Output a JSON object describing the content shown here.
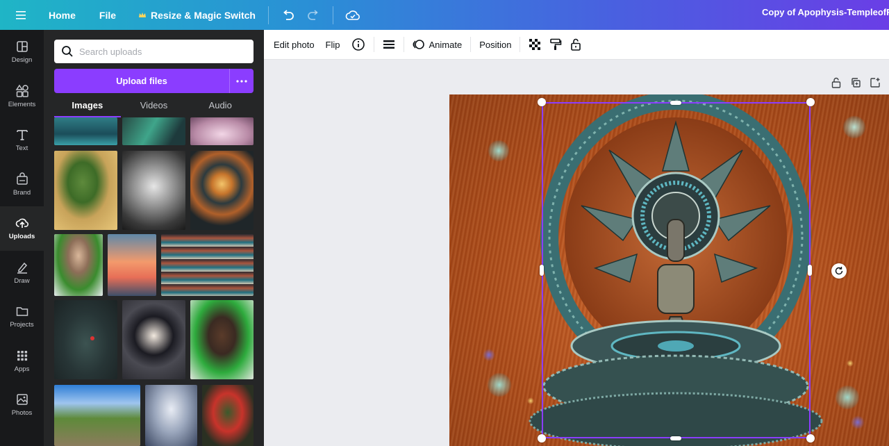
{
  "topbar": {
    "home": "Home",
    "file": "File",
    "resize": "Resize & Magic Switch",
    "doc_title": "Copy of Apophysis-TempleofRo"
  },
  "rail": {
    "items": [
      {
        "label": "Design",
        "icon": "design-icon"
      },
      {
        "label": "Elements",
        "icon": "elements-icon"
      },
      {
        "label": "Text",
        "icon": "text-icon"
      },
      {
        "label": "Brand",
        "icon": "brand-icon"
      },
      {
        "label": "Uploads",
        "icon": "upload-cloud-icon"
      },
      {
        "label": "Draw",
        "icon": "draw-icon"
      },
      {
        "label": "Projects",
        "icon": "folder-icon"
      },
      {
        "label": "Apps",
        "icon": "apps-grid-icon"
      },
      {
        "label": "Photos",
        "icon": "photo-icon"
      }
    ]
  },
  "panel": {
    "search_placeholder": "Search uploads",
    "upload_label": "Upload files",
    "tabs": [
      "Images",
      "Videos",
      "Audio"
    ]
  },
  "toolbar": {
    "edit_photo": "Edit photo",
    "flip": "Flip",
    "animate": "Animate",
    "position": "Position"
  },
  "colors": {
    "accent": "#8b3dff",
    "panel_bg": "#252627",
    "rail_bg": "#18191b"
  }
}
